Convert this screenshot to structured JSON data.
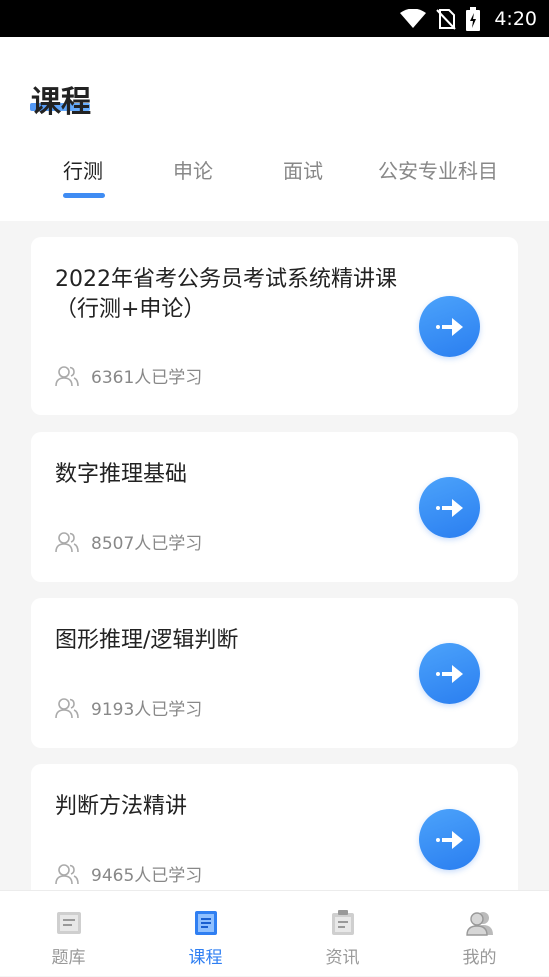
{
  "status_bar": {
    "time": "4:20"
  },
  "header": {
    "title": "课程"
  },
  "tabs": [
    {
      "label": "行测",
      "active": true
    },
    {
      "label": "申论",
      "active": false
    },
    {
      "label": "面试",
      "active": false
    },
    {
      "label": "公安专业科目",
      "active": false
    }
  ],
  "courses": [
    {
      "title": "2022年省考公务员考试系统精讲课（行测+申论）",
      "learners": "6361人已学习"
    },
    {
      "title": "数字推理基础",
      "learners": "8507人已学习"
    },
    {
      "title": "图形推理/逻辑判断",
      "learners": "9193人已学习"
    },
    {
      "title": "判断方法精讲",
      "learners": "9465人已学习"
    }
  ],
  "bottom_nav": [
    {
      "label": "题库",
      "icon": "question-bank-icon",
      "active": false
    },
    {
      "label": "课程",
      "icon": "course-icon",
      "active": true
    },
    {
      "label": "资讯",
      "icon": "news-icon",
      "active": false
    },
    {
      "label": "我的",
      "icon": "profile-icon",
      "active": false
    }
  ],
  "colors": {
    "accent": "#2f7ff2",
    "background": "#f5f5f5"
  }
}
